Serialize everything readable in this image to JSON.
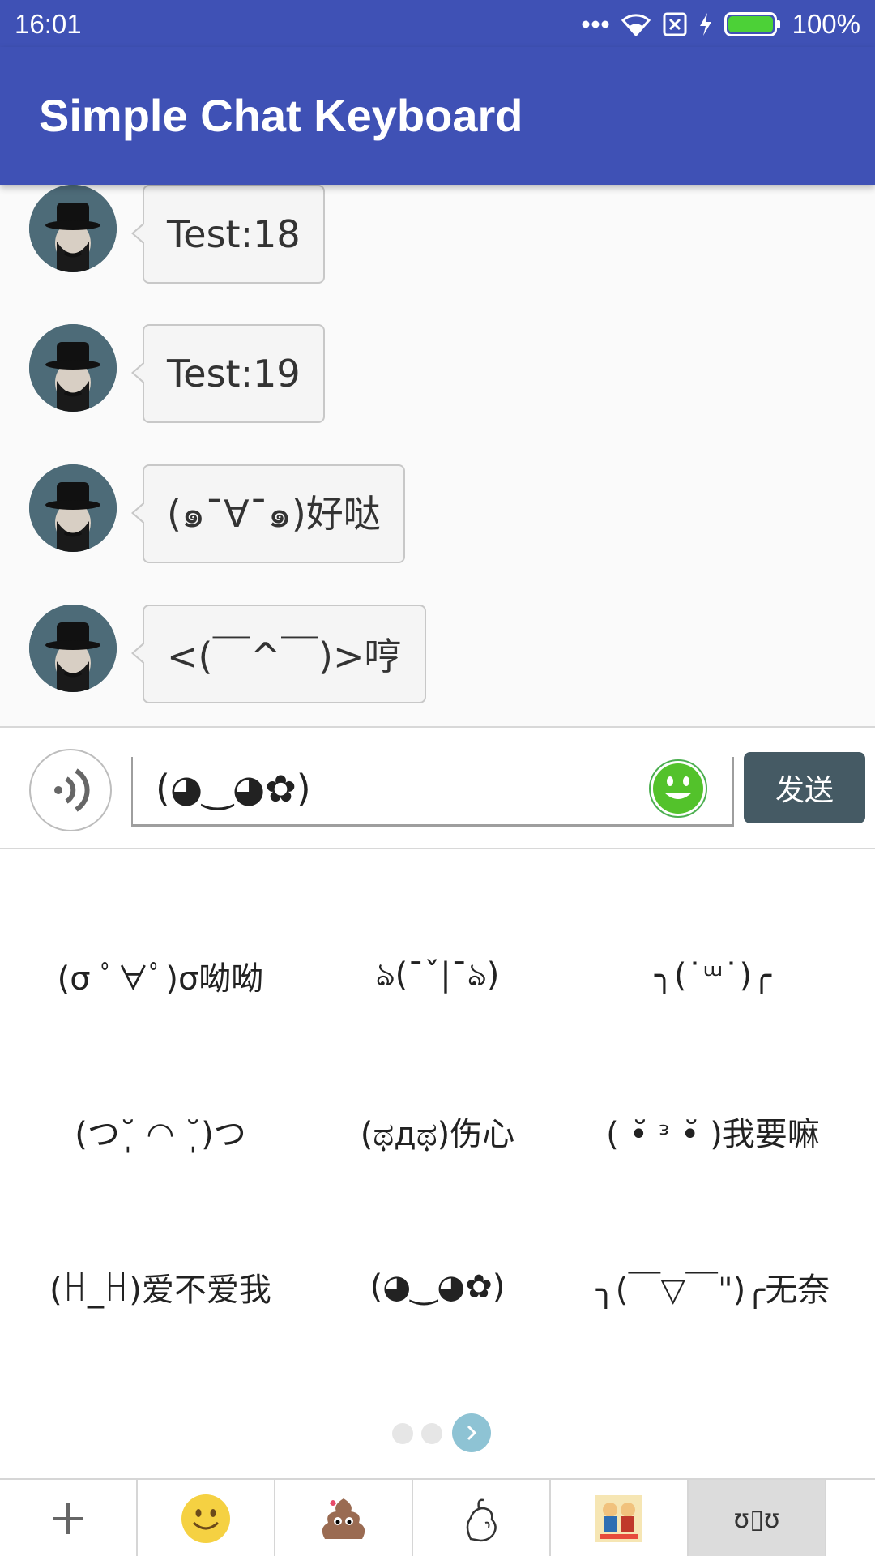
{
  "status_bar": {
    "time": "16:01",
    "battery_percent": "100%",
    "icons": [
      "more-dots-icon",
      "wifi-icon",
      "no-sim-icon",
      "charging-icon",
      "battery-icon"
    ]
  },
  "app_bar": {
    "title": "Simple Chat Keyboard",
    "color": "#3f51b5"
  },
  "messages": [
    {
      "text": "Test:18"
    },
    {
      "text": "Test:19"
    },
    {
      "text": "(๑¯∀¯๑)好哒"
    },
    {
      "text": "<(￣^￣)>哼"
    }
  ],
  "input": {
    "value": "(◕‿◕✿)",
    "send_label": "发送",
    "send_color": "#455a64"
  },
  "kaomoji": [
    "(σ ﾟ∀ﾟ)σ呦呦",
    "ঌ(¯ˇ|¯ঌ)",
    "╮(˙ᵚ˙)╭",
    "(つ˘̩ ◠ ˘̩)つ",
    "(ಥдಥ)伤心",
    "( •̆ ᵌ •̆ )我要嘛",
    "(ꀿ_ꀿ)爱不爱我",
    "(◕‿◕✿)",
    "╮(￣▽￣\")╭无奈"
  ],
  "pager": {
    "pages": 3,
    "current": 3,
    "next_icon": "chevron-right-icon"
  },
  "toolbar": {
    "tabs": [
      {
        "icon": "plus-icon"
      },
      {
        "icon": "smiley-icon"
      },
      {
        "icon": "sticker-poo-icon"
      },
      {
        "icon": "sticker-hand-icon"
      },
      {
        "icon": "sticker-cartoon-icon"
      },
      {
        "label": "ʊ▯ʊ",
        "selected": true
      }
    ]
  }
}
